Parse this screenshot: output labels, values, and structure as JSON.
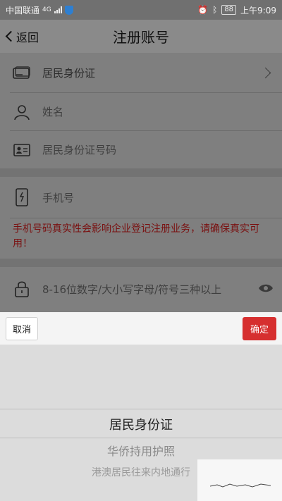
{
  "status_bar": {
    "carrier": "中国联通",
    "network": "4G",
    "battery": "88",
    "time": "上午9:09"
  },
  "nav": {
    "back_label": "返回",
    "title": "注册账号"
  },
  "form": {
    "id_type": {
      "label": "居民身份证",
      "icon": "id-card-icon"
    },
    "name": {
      "placeholder": "姓名",
      "icon": "person-icon"
    },
    "id_number": {
      "placeholder": "居民身份证号码",
      "icon": "contact-card-icon"
    },
    "phone": {
      "placeholder": "手机号",
      "icon": "phone-icon"
    },
    "phone_notice": "手机号码真实性会影响企业登记注册业务，请确保真实可用！",
    "password": {
      "placeholder": "8-16位数字/大小写字母/符号三种以上",
      "icon": "lock-icon",
      "toggle_icon": "eye-icon"
    }
  },
  "action_bar": {
    "cancel_label": "取消",
    "confirm_label": "确定"
  },
  "picker": {
    "options": [
      "居民身份证",
      "华侨持用护照",
      "港澳居民往来内地通行"
    ],
    "selected_index": 0
  },
  "colors": {
    "confirm_button": "#d62f2f",
    "notice_text": "#7a1010"
  }
}
